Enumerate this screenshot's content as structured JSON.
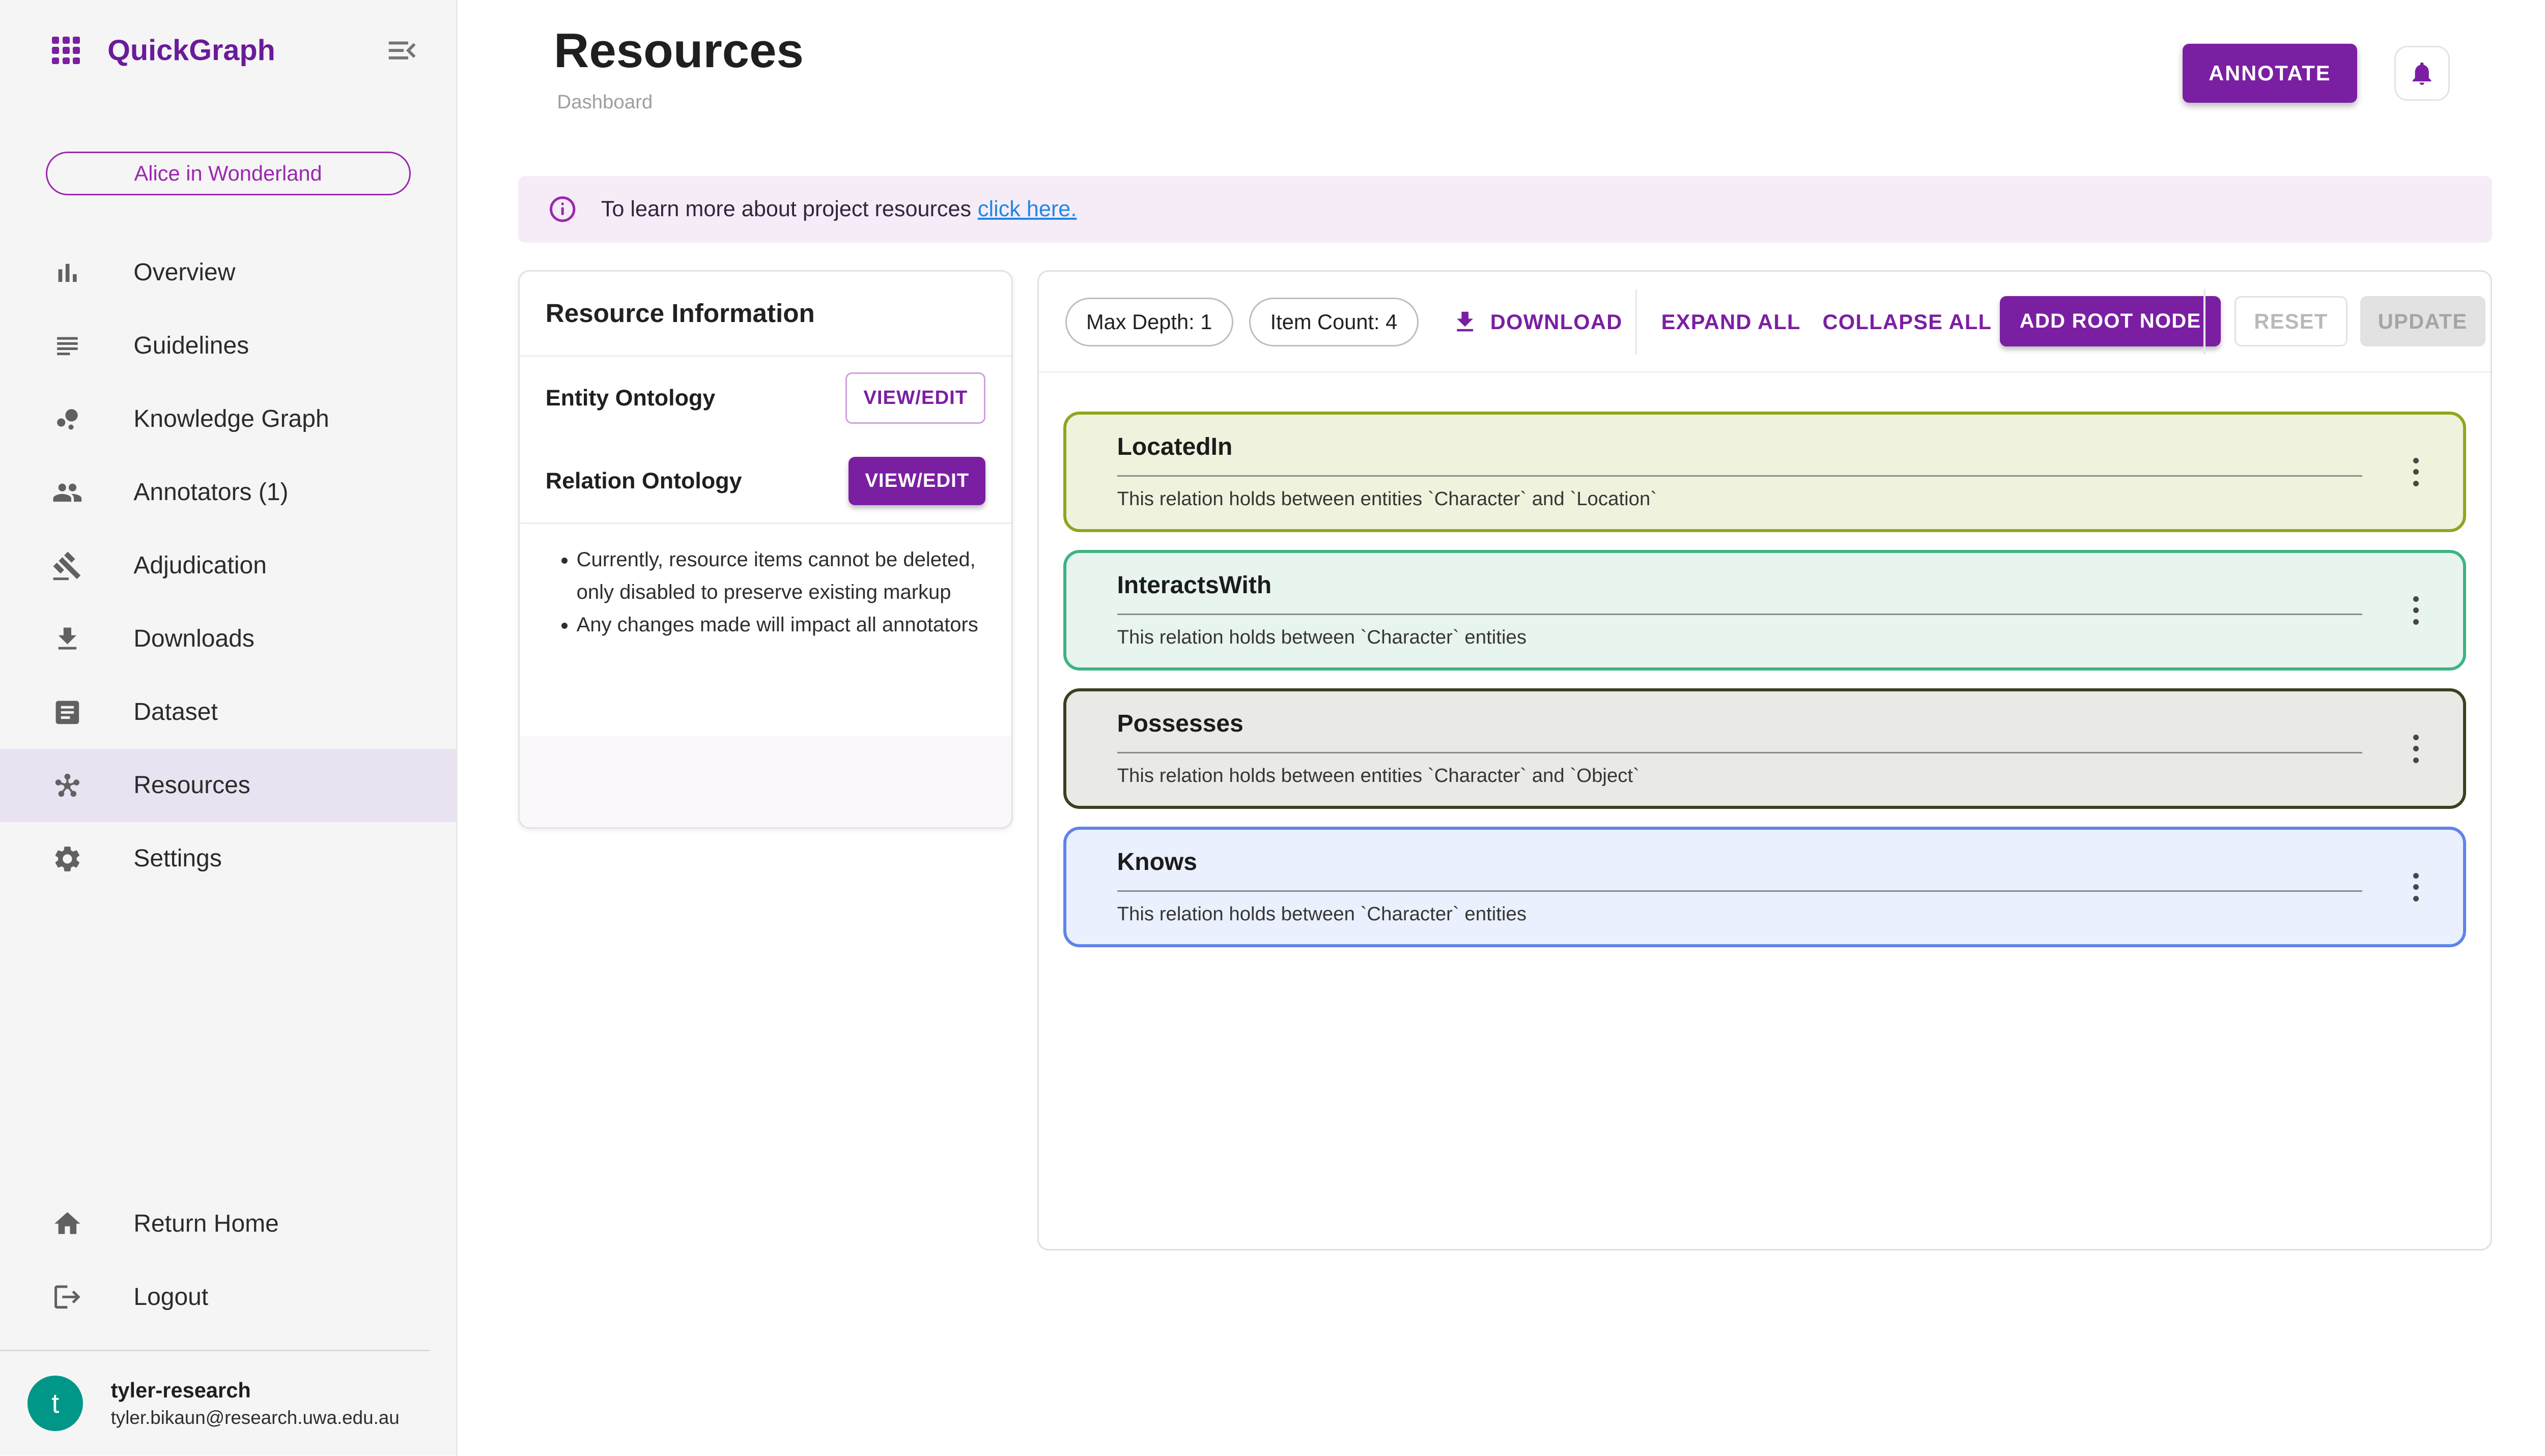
{
  "app": {
    "name": "QuickGraph"
  },
  "sidebar": {
    "project": "Alice in Wonderland",
    "items": [
      {
        "label": "Overview"
      },
      {
        "label": "Guidelines"
      },
      {
        "label": "Knowledge Graph"
      },
      {
        "label": "Annotators (1)"
      },
      {
        "label": "Adjudication"
      },
      {
        "label": "Downloads"
      },
      {
        "label": "Dataset"
      },
      {
        "label": "Resources",
        "selected": true
      },
      {
        "label": "Settings"
      }
    ],
    "footer": [
      {
        "label": "Return Home"
      },
      {
        "label": "Logout"
      }
    ],
    "user": {
      "initial": "t",
      "name": "tyler-research",
      "email": "tyler.bikaun@research.uwa.edu.au"
    }
  },
  "header": {
    "title": "Resources",
    "subtitle": "Dashboard",
    "annotate": "ANNOTATE"
  },
  "banner": {
    "text": "To learn more about project resources",
    "link": "click here."
  },
  "info_panel": {
    "title": "Resource Information",
    "rows": [
      {
        "label": "Entity Ontology",
        "button": "VIEW/EDIT",
        "variant": "outlined"
      },
      {
        "label": "Relation Ontology",
        "button": "VIEW/EDIT",
        "variant": "filled"
      }
    ],
    "notes": [
      "Currently, resource items cannot be deleted, only disabled to preserve existing markup",
      "Any changes made will impact all annotators"
    ]
  },
  "tree": {
    "max_depth_chip": "Max Depth: 1",
    "item_count_chip": "Item Count: 4",
    "download": "DOWNLOAD",
    "expand_all": "EXPAND ALL",
    "collapse_all": "COLLAPSE ALL",
    "add_root_node": "ADD ROOT NODE",
    "reset": "RESET",
    "update": "UPDATE",
    "cards": [
      {
        "title": "LocatedIn",
        "description": "This relation holds between entities `Character` and `Location`",
        "border_color": "#8FA61F",
        "bg_color": "#EFF3DD"
      },
      {
        "title": "InteractsWith",
        "description": "This relation holds between `Character` entities",
        "border_color": "#3FB383",
        "bg_color": "#E8F4EE"
      },
      {
        "title": "Possesses",
        "description": "This relation holds between entities `Character` and `Object`",
        "border_color": "#39411F",
        "bg_color": "#E9E9E6"
      },
      {
        "title": "Knows",
        "description": "This relation holds between `Character` entities",
        "border_color": "#6083E8",
        "bg_color": "#EAF0FD"
      }
    ]
  },
  "colors": {
    "brand": "#7B1FA2",
    "logo": "#6A1B9A",
    "chip_purple": "#9C27B0",
    "link_blue": "#1E88E5",
    "banner_bg": "#F6ECF8",
    "sidebar_selected_bg": "#E9E2F0",
    "avatar_teal": "#009688"
  }
}
